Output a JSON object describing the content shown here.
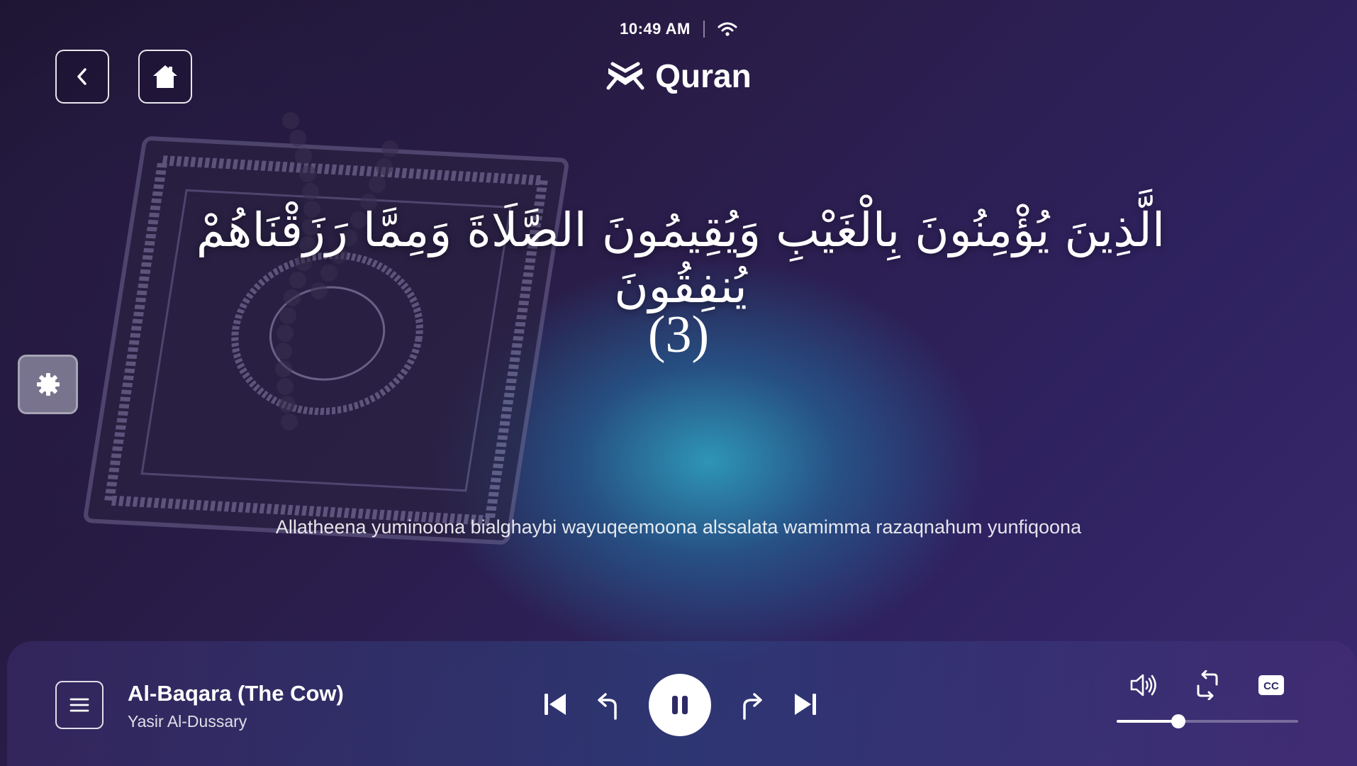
{
  "status_bar": {
    "time": "10:49 AM",
    "wifi_icon": "wifi-icon"
  },
  "header": {
    "title": "Quran",
    "logo_icon": "open-book-icon",
    "back_icon": "chevron-left-icon",
    "home_icon": "home-icon"
  },
  "verse": {
    "arabic": "الَّذِينَ يُؤْمِنُونَ بِالْغَيْبِ وَيُقِيمُونَ الصَّلَاةَ وَمِمَّا رَزَقْنَاهُمْ يُنفِقُونَ",
    "number": "(3)",
    "transliteration": "Allatheena yuminoona bialghaybi wayuqeemoona alssalata wamimma razaqnahum yunfiqoona"
  },
  "side": {
    "settings_icon": "gear-icon"
  },
  "player": {
    "track_title": "Al-Baqara (The Cow)",
    "reciter": "Yasir Al-Dussary",
    "is_playing": true,
    "volume": 0.34,
    "icons": {
      "queue": "list-icon",
      "previous": "skip-previous-icon",
      "rewind": "rewind-icon",
      "pause": "pause-icon",
      "forward": "forward-icon",
      "next": "skip-next-icon",
      "volume": "volume-icon",
      "repeat": "repeat-icon",
      "captions": "cc-icon"
    }
  },
  "colors": {
    "background_dark": "#1d1532",
    "background_purple": "#3a2a6e",
    "glow_teal": "#2eaac8",
    "foreground": "#ffffff"
  }
}
